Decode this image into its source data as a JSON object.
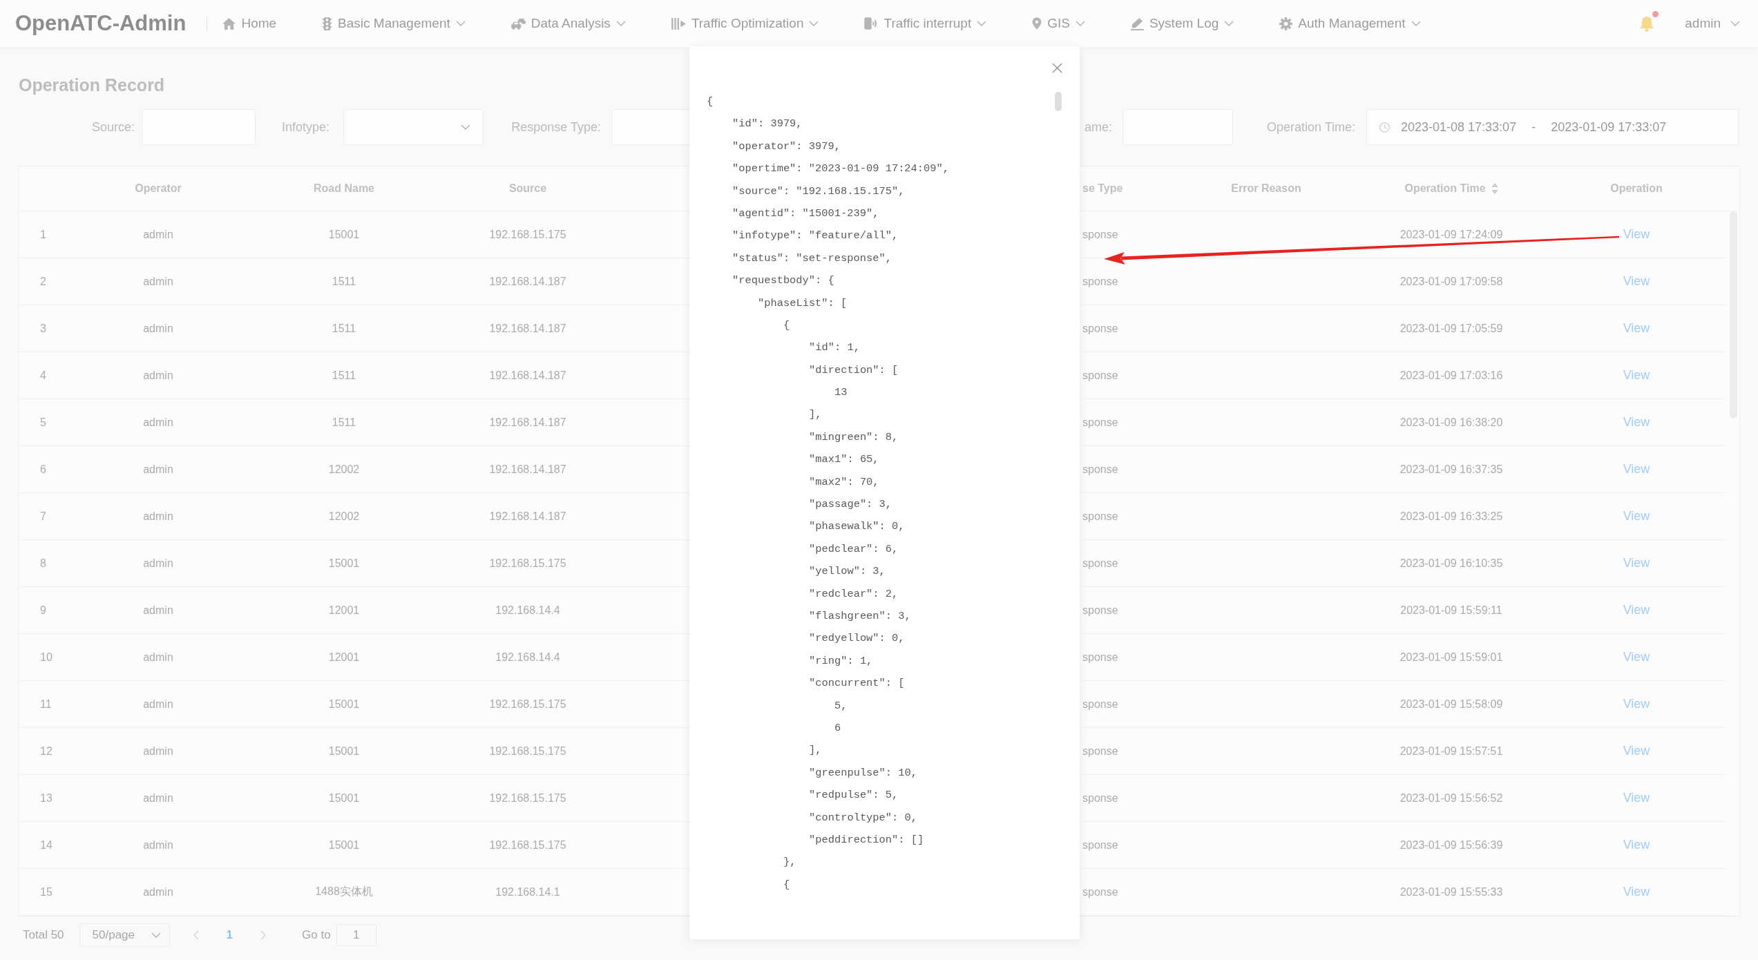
{
  "header": {
    "logo": "OpenATC-Admin",
    "nav": [
      {
        "label": "Home",
        "dropdown": false
      },
      {
        "label": "Basic Management",
        "dropdown": true
      },
      {
        "label": "Data Analysis",
        "dropdown": true
      },
      {
        "label": "Traffic Optimization",
        "dropdown": true
      },
      {
        "label": "Traffic interrupt",
        "dropdown": true
      },
      {
        "label": "GIS",
        "dropdown": true
      },
      {
        "label": "System Log",
        "dropdown": true
      },
      {
        "label": "Auth Management",
        "dropdown": true
      }
    ],
    "notifications": {
      "unread": true
    },
    "user": {
      "name": "admin",
      "dropdown": true
    }
  },
  "page": {
    "title": "Operation Record"
  },
  "filters": [
    {
      "kind": "text",
      "label": "Source:"
    },
    {
      "kind": "select",
      "label": "Infotype:"
    },
    {
      "kind": "text",
      "label": "Response Type:"
    },
    {
      "kind": "text",
      "label": "ame:"
    },
    {
      "kind": "daterange",
      "label": "Operation Time:",
      "start": "2023-01-08 17:33:07",
      "separator": "-",
      "end": "2023-01-09 17:33:07"
    }
  ],
  "table": {
    "columns": [
      {
        "label": "Operator",
        "sortable": false
      },
      {
        "label": "Road Name",
        "sortable": false
      },
      {
        "label": "Source",
        "sortable": false
      },
      {
        "label": "se Type",
        "sortable": false
      },
      {
        "label": "Error Reason",
        "sortable": false
      },
      {
        "label": "Operation Time",
        "sortable": true
      },
      {
        "label": "Operation",
        "sortable": false
      }
    ],
    "rows": [
      {
        "no": "1",
        "operator": "admin",
        "road_name": "15001",
        "source": "192.168.15.175",
        "response_type": "sponse",
        "operation_time": "2023-01-09 17:24:09",
        "action": "View"
      },
      {
        "no": "2",
        "operator": "admin",
        "road_name": "1511",
        "source": "192.168.14.187",
        "response_type": "sponse",
        "operation_time": "2023-01-09 17:09:58",
        "action": "View"
      },
      {
        "no": "3",
        "operator": "admin",
        "road_name": "1511",
        "source": "192.168.14.187",
        "response_type": "sponse",
        "operation_time": "2023-01-09 17:05:59",
        "action": "View"
      },
      {
        "no": "4",
        "operator": "admin",
        "road_name": "1511",
        "source": "192.168.14.187",
        "response_type": "sponse",
        "operation_time": "2023-01-09 17:03:16",
        "action": "View"
      },
      {
        "no": "5",
        "operator": "admin",
        "road_name": "1511",
        "source": "192.168.14.187",
        "response_type": "sponse",
        "operation_time": "2023-01-09 16:38:20",
        "action": "View"
      },
      {
        "no": "6",
        "operator": "admin",
        "road_name": "12002",
        "source": "192.168.14.187",
        "response_type": "sponse",
        "operation_time": "2023-01-09 16:37:35",
        "action": "View"
      },
      {
        "no": "7",
        "operator": "admin",
        "road_name": "12002",
        "source": "192.168.14.187",
        "response_type": "sponse",
        "operation_time": "2023-01-09 16:33:25",
        "action": "View"
      },
      {
        "no": "8",
        "operator": "admin",
        "road_name": "15001",
        "source": "192.168.15.175",
        "response_type": "sponse",
        "operation_time": "2023-01-09 16:10:35",
        "action": "View"
      },
      {
        "no": "9",
        "operator": "admin",
        "road_name": "12001",
        "source": "192.168.14.4",
        "response_type": "sponse",
        "operation_time": "2023-01-09 15:59:11",
        "action": "View"
      },
      {
        "no": "10",
        "operator": "admin",
        "road_name": "12001",
        "source": "192.168.14.4",
        "response_type": "sponse",
        "operation_time": "2023-01-09 15:59:01",
        "action": "View"
      },
      {
        "no": "11",
        "operator": "admin",
        "road_name": "15001",
        "source": "192.168.15.175",
        "response_type": "sponse",
        "operation_time": "2023-01-09 15:58:09",
        "action": "View"
      },
      {
        "no": "12",
        "operator": "admin",
        "road_name": "15001",
        "source": "192.168.15.175",
        "response_type": "sponse",
        "operation_time": "2023-01-09 15:57:51",
        "action": "View"
      },
      {
        "no": "13",
        "operator": "admin",
        "road_name": "15001",
        "source": "192.168.15.175",
        "response_type": "sponse",
        "operation_time": "2023-01-09 15:56:52",
        "action": "View"
      },
      {
        "no": "14",
        "operator": "admin",
        "road_name": "15001",
        "source": "192.168.15.175",
        "response_type": "sponse",
        "operation_time": "2023-01-09 15:56:39",
        "action": "View"
      },
      {
        "no": "15",
        "operator": "admin",
        "road_name": "1488实体机",
        "source": "192.168.14.1",
        "response_type": "sponse",
        "operation_time": "2023-01-09 15:55:33",
        "action": "View"
      }
    ]
  },
  "pagination": {
    "total": "Total 50",
    "page_size": "50/page",
    "prev_disabled": true,
    "pages": [
      {
        "label": "1",
        "selected": true
      }
    ],
    "next_disabled": true,
    "goto_label": "Go to",
    "goto_value": "1"
  },
  "dialog": {
    "code_lines": [
      {
        "text": "{",
        "children": [
          {
            "text": "\"id\": 3979,"
          },
          {
            "text": "\"operator\": 3979,"
          },
          {
            "text": "\"opertime\": \"2023-01-09 17:24:09\","
          },
          {
            "text": "\"source\": \"192.168.15.175\","
          },
          {
            "text": "\"agentid\": \"15001-239\","
          },
          {
            "text": "\"infotype\": \"feature/all\","
          },
          {
            "text": "\"status\": \"set-response\","
          },
          {
            "text": "\"requestbody\": {",
            "children": [
              {
                "text": "\"phaseList\": [",
                "children": [
                  {
                    "text": "{",
                    "children": [
                      {
                        "text": "\"id\": 1,"
                      },
                      {
                        "text": "\"direction\": [",
                        "children": [
                          {
                            "text": "13"
                          }
                        ]
                      },
                      {
                        "text": "],"
                      },
                      {
                        "text": "\"mingreen\": 8,"
                      },
                      {
                        "text": "\"max1\": 65,"
                      },
                      {
                        "text": "\"max2\": 70,"
                      },
                      {
                        "text": "\"passage\": 3,"
                      },
                      {
                        "text": "\"phasewalk\": 0,"
                      },
                      {
                        "text": "\"pedclear\": 6,"
                      },
                      {
                        "text": "\"yellow\": 3,"
                      },
                      {
                        "text": "\"redclear\": 2,"
                      },
                      {
                        "text": "\"flashgreen\": 3,"
                      },
                      {
                        "text": "\"redyellow\": 0,"
                      },
                      {
                        "text": "\"ring\": 1,"
                      },
                      {
                        "text": "\"concurrent\": [",
                        "children": [
                          {
                            "text": "5,"
                          },
                          {
                            "text": "6"
                          }
                        ]
                      },
                      {
                        "text": "],"
                      },
                      {
                        "text": "\"greenpulse\": 10,"
                      },
                      {
                        "text": "\"redpulse\": 5,"
                      },
                      {
                        "text": "\"controltype\": 0,"
                      },
                      {
                        "text": "\"peddirection\": []"
                      }
                    ]
                  },
                  {
                    "text": "},"
                  },
                  {
                    "text": "{"
                  }
                ]
              }
            ]
          }
        ]
      }
    ]
  }
}
